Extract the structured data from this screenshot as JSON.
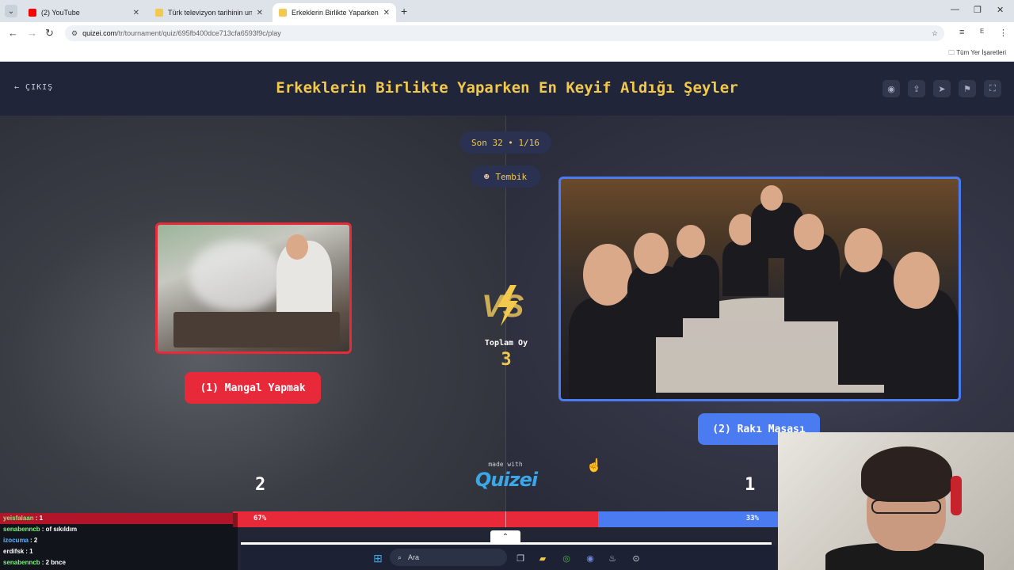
{
  "browser": {
    "tabs": [
      {
        "title": "(2) YouTube",
        "favicon_color": "#ff0000"
      },
      {
        "title": "Türk televizyon tarihinin unutul",
        "favicon_color": "#f2c94c"
      },
      {
        "title": "Erkeklerin Birlikte Yaparken En",
        "favicon_color": "#f2c94c"
      }
    ],
    "url_host": "quizei.com",
    "url_path": "/tr/tournament/quiz/695fb400dce713cfa6593f9c/play",
    "bookmarks_label": "Tüm Yer İşaretleri"
  },
  "header": {
    "back_label": "ÇIKIŞ",
    "title": "Erkeklerin Birlikte Yaparken En Keyif Aldığı Şeyler",
    "icons": [
      "eye-icon",
      "share-icon",
      "send-icon",
      "flag-icon",
      "fullscreen-icon"
    ]
  },
  "match": {
    "round_label": "Son 32 • 1/16",
    "user_label": "Tembik",
    "left_choice": "(1) Mangal Yapmak",
    "right_choice": "(2) Rakı Masası",
    "total_label": "Toplam Oy",
    "total_votes": "3",
    "left_score": "2",
    "right_score": "1",
    "left_percent": "67%",
    "right_percent": "33%",
    "left_fraction": 0.67,
    "made_with": "made with",
    "brand": "QUIZEI"
  },
  "chat": [
    {
      "user": "yeisfalaan",
      "msg": ": 1",
      "color": "#7cf27c"
    },
    {
      "user": "senabenncb",
      "msg": ": of sıkıldım",
      "color": "#7cf27c"
    },
    {
      "user": "izocuma",
      "msg": ": 2",
      "color": "#5fb4ff"
    },
    {
      "user": "erdifsk",
      "msg": ": 1",
      "color": "#ffffff"
    },
    {
      "user": "senabenncb",
      "msg": ": 2 bnce",
      "color": "#7cf27c"
    }
  ],
  "taskbar": {
    "search_placeholder": "Ara"
  },
  "colors": {
    "accent_yellow": "#f2c94c",
    "red": "#e8293a",
    "blue": "#4a7bf0"
  }
}
